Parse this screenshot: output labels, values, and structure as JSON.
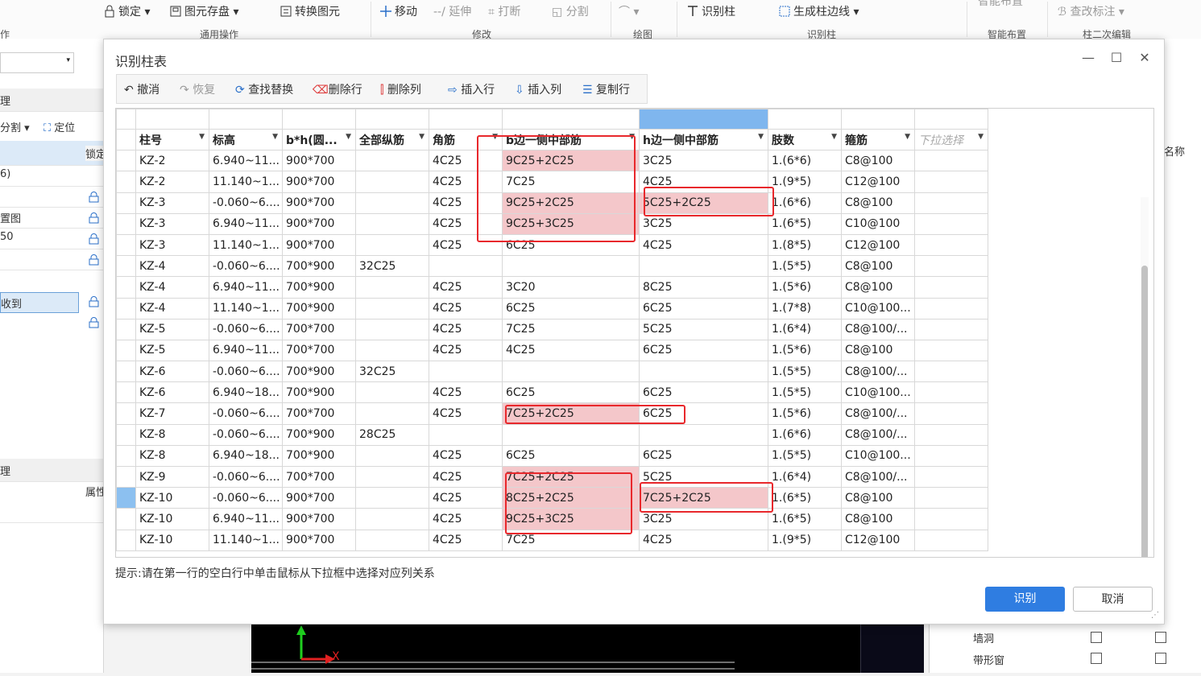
{
  "ribbon": {
    "buttons": [
      {
        "label": "锁定",
        "icon": "lock-icon",
        "dropdown": true
      },
      {
        "label": "图元存盘",
        "icon": "save-element-icon",
        "dropdown": true
      },
      {
        "label": "转换图元",
        "icon": "convert-icon"
      },
      {
        "label": "移动",
        "icon": "move-icon"
      },
      {
        "label": "延伸",
        "icon": "extend-icon",
        "disabled": true
      },
      {
        "label": "打断",
        "icon": "break-icon",
        "disabled": true
      },
      {
        "label": "分割",
        "icon": "split-icon",
        "disabled": true
      },
      {
        "label": "",
        "icon": "arc-icon",
        "dropdown": true,
        "disabled": true
      },
      {
        "label": "识别柱",
        "icon": "recognize-column-icon"
      },
      {
        "label": "生成柱边线",
        "icon": "column-edge-icon",
        "dropdown": true
      },
      {
        "label": "智能布置",
        "icon": "smart-layout-icon",
        "disabled": true
      },
      {
        "label": "查改标注",
        "icon": "annotation-icon",
        "dropdown": true,
        "disabled": true
      }
    ],
    "group_labels": [
      "作",
      "通用操作",
      "修改",
      "绘图",
      "识别柱",
      "智能布置",
      "柱二次编辑"
    ]
  },
  "left_panel": {
    "split_label": "分割",
    "locate_label": "定位",
    "lock_header": "锁定",
    "items": [
      "6)",
      "置图",
      "50",
      "",
      "收到",
      ""
    ],
    "property_label": "属性",
    "section1": "理",
    "section2": "理"
  },
  "right_panel": {
    "name_header": "名称"
  },
  "bottom_table": {
    "rows": [
      "墙洞",
      "带形窗"
    ]
  },
  "dialog": {
    "title": "识别柱表",
    "window_buttons": [
      "—",
      "☐",
      "✕"
    ],
    "toolbar": [
      {
        "label": "撤消",
        "icon": "undo-icon"
      },
      {
        "label": "恢复",
        "icon": "redo-icon",
        "disabled": true
      },
      {
        "label": "查找替换",
        "icon": "find-replace-icon"
      },
      {
        "label": "删除行",
        "icon": "delete-row-icon"
      },
      {
        "label": "删除列",
        "icon": "delete-column-icon"
      },
      {
        "label": "插入行",
        "icon": "insert-row-icon"
      },
      {
        "label": "插入列",
        "icon": "insert-column-icon"
      },
      {
        "label": "复制行",
        "icon": "copy-row-icon"
      }
    ],
    "columns": [
      "柱号",
      "标高",
      "b*h(圆...",
      "全部纵筋",
      "角筋",
      "b边一侧中部筋",
      "h边一侧中部筋",
      "肢数",
      "箍筋",
      "下拉选择"
    ],
    "rows": [
      [
        "KZ-2",
        "6.940~11...",
        "900*700",
        "",
        "4C25",
        "9C25+2C25",
        "3C25",
        "1.(6*6)",
        "C8@100",
        ""
      ],
      [
        "KZ-2",
        "11.140~1...",
        "900*700",
        "",
        "4C25",
        "7C25",
        "4C25",
        "1.(9*5)",
        "C12@100",
        ""
      ],
      [
        "KZ-3",
        "-0.060~6....",
        "900*700",
        "",
        "4C25",
        "9C25+2C25",
        "5C25+2C25",
        "1.(6*6)",
        "C8@100",
        ""
      ],
      [
        "KZ-3",
        "6.940~11...",
        "900*700",
        "",
        "4C25",
        "9C25+3C25",
        "3C25",
        "1.(6*5)",
        "C10@100",
        ""
      ],
      [
        "KZ-3",
        "11.140~1...",
        "900*700",
        "",
        "4C25",
        "6C25",
        "4C25",
        "1.(8*5)",
        "C12@100",
        ""
      ],
      [
        "KZ-4",
        "-0.060~6....",
        "700*900",
        "32C25",
        "",
        "",
        "",
        "1.(5*5)",
        "C8@100",
        ""
      ],
      [
        "KZ-4",
        "6.940~11...",
        "700*900",
        "",
        "4C25",
        "3C20",
        "8C25",
        "1.(5*6)",
        "C8@100",
        ""
      ],
      [
        "KZ-4",
        "11.140~1...",
        "700*900",
        "",
        "4C25",
        "6C25",
        "6C25",
        "1.(7*8)",
        "C10@100...",
        ""
      ],
      [
        "KZ-5",
        "-0.060~6....",
        "700*700",
        "",
        "4C25",
        "7C25",
        "5C25",
        "1.(6*4)",
        "C8@100/...",
        ""
      ],
      [
        "KZ-5",
        "6.940~11...",
        "700*700",
        "",
        "4C25",
        "4C25",
        "6C25",
        "1.(5*6)",
        "C8@100",
        ""
      ],
      [
        "KZ-6",
        "-0.060~6....",
        "700*900",
        "32C25",
        "",
        "",
        "",
        "1.(5*5)",
        "C8@100/...",
        ""
      ],
      [
        "KZ-6",
        "6.940~18...",
        "700*900",
        "",
        "4C25",
        "6C25",
        "6C25",
        "1.(5*5)",
        "C10@100...",
        ""
      ],
      [
        "KZ-7",
        "-0.060~6....",
        "700*700",
        "",
        "4C25",
        "7C25+2C25",
        "6C25",
        "1.(5*6)",
        "C8@100/...",
        ""
      ],
      [
        "KZ-8",
        "-0.060~6....",
        "700*900",
        "28C25",
        "",
        "",
        "",
        "1.(6*6)",
        "C8@100/...",
        ""
      ],
      [
        "KZ-8",
        "6.940~18...",
        "700*900",
        "",
        "4C25",
        "6C25",
        "6C25",
        "1.(5*5)",
        "C10@100...",
        ""
      ],
      [
        "KZ-9",
        "-0.060~6....",
        "700*700",
        "",
        "4C25",
        "7C25+2C25",
        "5C25",
        "1.(6*4)",
        "C8@100/...",
        ""
      ],
      [
        "KZ-10",
        "-0.060~6....",
        "900*700",
        "",
        "4C25",
        "8C25+2C25",
        "7C25+2C25",
        "1.(6*5)",
        "C8@100",
        ""
      ],
      [
        "KZ-10",
        "6.940~11...",
        "900*700",
        "",
        "4C25",
        "9C25+3C25",
        "3C25",
        "1.(6*5)",
        "C8@100",
        ""
      ],
      [
        "KZ-10",
        "11.140~1...",
        "900*700",
        "",
        "4C25",
        "7C25",
        "4C25",
        "1.(9*5)",
        "C12@100",
        ""
      ]
    ],
    "highlighted_cells": [
      [
        0,
        5
      ],
      [
        2,
        5
      ],
      [
        3,
        5
      ],
      [
        12,
        5
      ],
      [
        15,
        5
      ],
      [
        16,
        5
      ],
      [
        17,
        5
      ],
      [
        2,
        6
      ],
      [
        16,
        6
      ]
    ],
    "current_row": 16,
    "tip": "提示:请在第一行的空白行中单击鼠标从下拉框中选择对应列关系",
    "ok_label": "识别",
    "cancel_label": "取消"
  },
  "colors": {
    "accent": "#2f7de1",
    "highlight": "#f4c7ca",
    "callout": "#e8282c",
    "selected_header": "#7fb6ee"
  }
}
